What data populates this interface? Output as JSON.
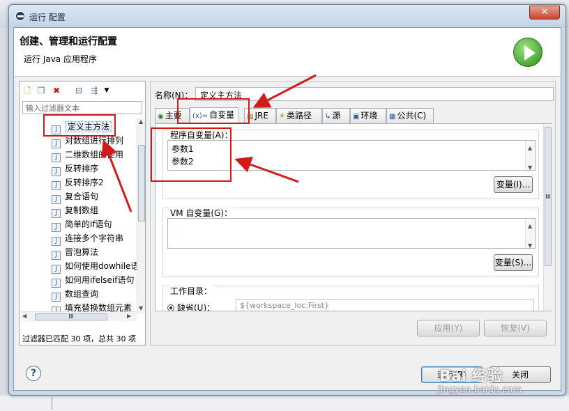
{
  "window": {
    "title": "运行 配置",
    "close_label": "✕"
  },
  "header": {
    "title": "创建、管理和运行配置",
    "subtitle": "运行 Java 应用程序"
  },
  "left": {
    "toolbar_icons": [
      "new-config-icon",
      "duplicate-icon",
      "delete-icon",
      "collapse-all-icon",
      "filter-icon",
      "dropdown-icon"
    ],
    "filter_placeholder": "输入过滤器文本",
    "tree_items": [
      "定义主方法",
      "对数组进行排列",
      "二维数组的使用",
      "反转排序",
      "反转排序2",
      "复合语句",
      "复制数组",
      "简单的if语句",
      "连接多个字符串",
      "冒泡算法",
      "如何使用dowhile语",
      "如何用ifelseif语句",
      "数组查询",
      "填充替换数组元素"
    ],
    "selected_index": 0,
    "hscroll_label": "III",
    "status": "过滤器已匹配 30 项，总共 30 项"
  },
  "right": {
    "name_label": "名称(N)：",
    "name_value": "定义主方法",
    "tabs": [
      "主要",
      "自变量",
      "JRE",
      "类路径",
      "源",
      "环境",
      "公共(C)"
    ],
    "active_tab": 1,
    "program_args": {
      "label": "程序自变量(A)：",
      "lines": [
        "参数1",
        "参数2"
      ],
      "button": "变量(I)..."
    },
    "vm_args": {
      "label": "VM 自变量(G)：",
      "value": "",
      "button": "变量(S)..."
    },
    "workdir": {
      "label": "工作目录：",
      "default_label": "缺省(U)：",
      "default_value": "${workspace_loc:First}"
    },
    "apply_label": "应用(Y)",
    "revert_label": "恢复(V)",
    "scroll_label": "III"
  },
  "footer": {
    "help_label": "?",
    "run_label": "运行(R)",
    "close_label": "关闭"
  },
  "watermark": {
    "brand": "Bai 经验",
    "url": "jingyan.baidu.com"
  },
  "colors": {
    "annotation": "#d11a1a",
    "accent": "#2b8d1b"
  }
}
